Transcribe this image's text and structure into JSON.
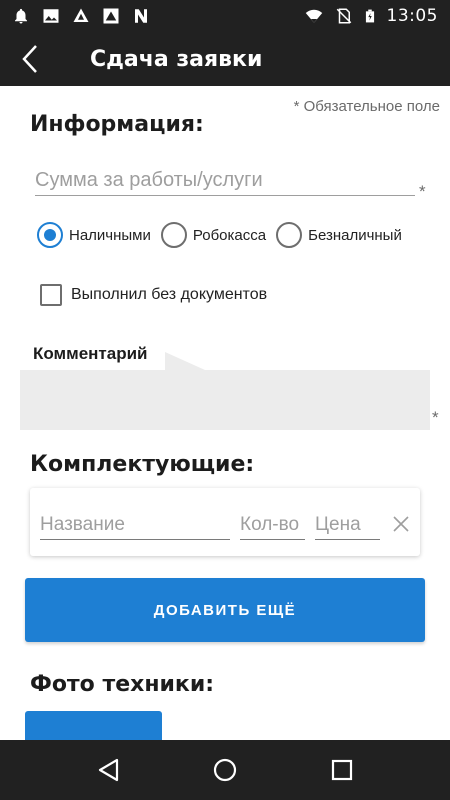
{
  "status_bar": {
    "time": "13:05",
    "left_icons": [
      "notification-bell-icon",
      "image-icon",
      "drive-icon",
      "drive-icon",
      "n-app-icon"
    ],
    "right_icons": [
      "wifi-icon",
      "no-sim-icon",
      "battery-charging-icon"
    ]
  },
  "app_bar": {
    "title": "Сдача заявки",
    "back_icon": "chevron-left-icon"
  },
  "form": {
    "required_note": "* Обязательное поле",
    "info_title": "Информация:",
    "amount_placeholder": "Сумма за работы/услуги",
    "required_star": "*",
    "payment_options": [
      {
        "label": "Наличными",
        "checked": true
      },
      {
        "label": "Робокасса",
        "checked": false
      },
      {
        "label": "Безналичный",
        "checked": false
      }
    ],
    "no_docs_label": "Выполнил без документов",
    "no_docs_checked": false,
    "comment_label": "Комментарий",
    "comment_star": "*",
    "parts_title": "Комплектующие:",
    "parts": {
      "name_placeholder": "Название",
      "qty_placeholder": "Кол-во",
      "price_placeholder": "Цена"
    },
    "add_more_label": "ДОБАВИТЬ ЕЩЁ",
    "photo_title": "Фото техники:"
  },
  "colors": {
    "accent": "#1e7fd3",
    "bar_background": "#212121",
    "comment_background": "#ececec"
  },
  "nav_bar": {
    "icons": [
      "back-triangle-icon",
      "home-circle-icon",
      "recents-square-icon"
    ]
  }
}
